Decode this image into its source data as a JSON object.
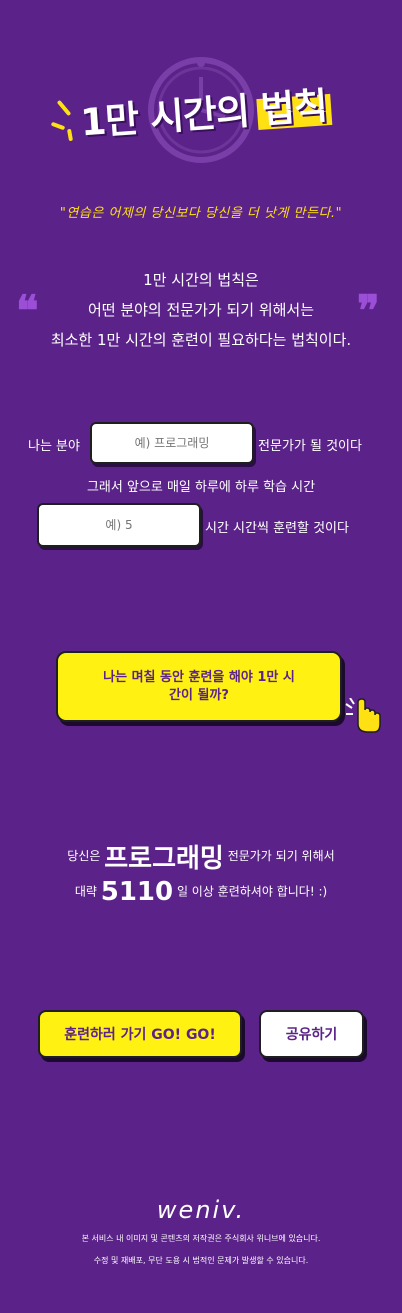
{
  "header": {
    "title_part1": "1만 시간의 ",
    "title_part2": "법칙",
    "clock_icon": "clock-icon"
  },
  "quote": "\"연습은 어제의 당신보다 당신을 더 낫게 만든다.\"",
  "law": {
    "line1": "1만 시간의 법칙은",
    "line2": "어떤 분야의 전문가가 되기 위해서는",
    "line3": "최소한 1만 시간의 훈련이 필요하다는 법칙이다.",
    "open_quote": "❝",
    "close_quote": "❞"
  },
  "form": {
    "field_prefix": "나는 분야",
    "field_placeholder": "예) 프로그래밍",
    "field_suffix": "전문가가 될 것이다",
    "middle_text": "그래서 앞으로 매일 하루에 하루 학습 시간",
    "time_placeholder": "예) 5",
    "time_suffix": "시간 시간씩 훈련할 것이다"
  },
  "cta": {
    "label": "나는 며칠 동안 훈련을 해야 1만 시간이 될까?",
    "icon": "pointer-hand-icon"
  },
  "result": {
    "prefix": "당신은",
    "field": "프로그래밍",
    "suffix": "전문가가 되기 위해서",
    "days_prefix": "대략",
    "days": "5110",
    "days_suffix": "일 이상 훈련하셔야 합니다! :)"
  },
  "buttons": {
    "go": "훈련하러 가기 GO! GO!",
    "share": "공유하기"
  },
  "footer": {
    "brand": "weniv.",
    "line1": "본 서비스 내 이미지 및 콘텐츠의 저작권은 주식회사 위니브에 있습니다.",
    "line2": "수정 및 재배포, 무단 도용 시 법적인 문제가 발생할 수 있습니다."
  },
  "colors": {
    "background": "#5b2389",
    "accent_yellow": "#fff212",
    "quote_yellow": "#ffe012",
    "quote_mark": "#9b4fd6"
  }
}
